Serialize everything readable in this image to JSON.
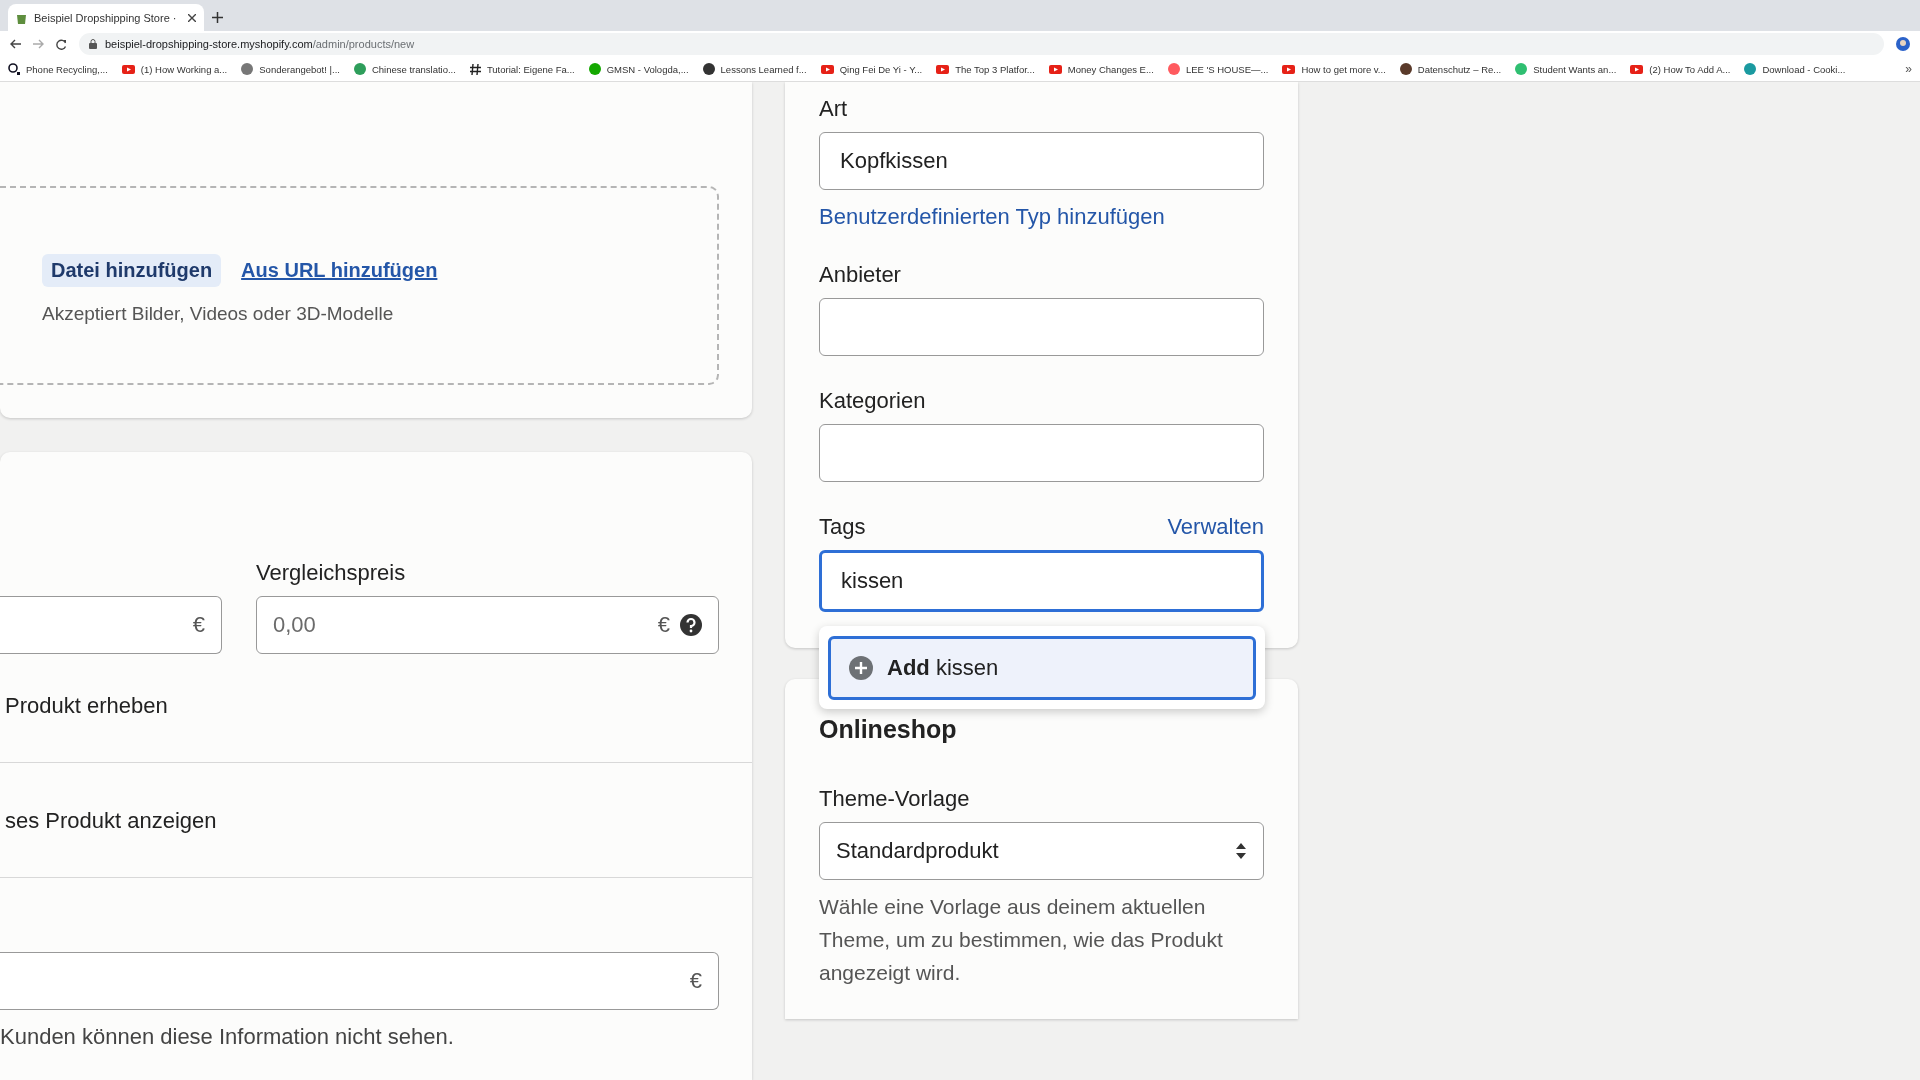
{
  "browser": {
    "tab_title": "Beispiel Dropshipping Store ·",
    "url_host": "beispiel-dropshipping-store.myshopify.com",
    "url_path": "/admin/products/new",
    "bookmarks": [
      {
        "label": "Phone Recycling,...",
        "kind": "ring"
      },
      {
        "label": "(1) How Working a...",
        "kind": "video"
      },
      {
        "label": "Sonderangebot! |...",
        "kind": "dot",
        "color": "#777777"
      },
      {
        "label": "Chinese translatio...",
        "kind": "dot",
        "color": "#2e9e5b"
      },
      {
        "label": "Tutorial: Eigene Fa...",
        "kind": "hash"
      },
      {
        "label": "GMSN - Vologda,...",
        "kind": "dot",
        "color": "#14a800"
      },
      {
        "label": "Lessons Learned f...",
        "kind": "dot",
        "color": "#333333"
      },
      {
        "label": "Qing Fei De Yi - Y...",
        "kind": "video"
      },
      {
        "label": "The Top 3 Platfor...",
        "kind": "video"
      },
      {
        "label": "Money Changes E...",
        "kind": "video"
      },
      {
        "label": "LEE 'S HOUSE—...",
        "kind": "dot",
        "color": "#ff5a5f"
      },
      {
        "label": "How to get more v...",
        "kind": "video"
      },
      {
        "label": "Datenschutz – Re...",
        "kind": "dot",
        "color": "#5a3a2a"
      },
      {
        "label": "Student Wants an...",
        "kind": "dot",
        "color": "#2fbf71"
      },
      {
        "label": "(2) How To Add A...",
        "kind": "video"
      },
      {
        "label": "Download - Cooki...",
        "kind": "dot",
        "color": "#1a9aa0"
      }
    ],
    "more": "»"
  },
  "media": {
    "add_file": "Datei hinzufügen",
    "add_url": "Aus URL hinzufügen",
    "hint": "Akzeptiert Bilder, Videos oder 3D-Modelle"
  },
  "pricing": {
    "price_currency": "€",
    "compare_label": "Vergleichspreis",
    "compare_placeholder": "0,00",
    "compare_currency": "€",
    "option_1": "Produkt erheben",
    "option_2": "ses Produkt anzeigen",
    "cost_currency": "€",
    "cost_note": "Kunden können diese Information nicht sehen."
  },
  "organization": {
    "fields": [
      {
        "label": "Art",
        "value": "Kopfkissen",
        "focused": false,
        "link": "Benutzerdefinierten Typ hinzufügen"
      },
      {
        "label": "Anbieter",
        "focused": false
      },
      {
        "label": "Kategorien",
        "focused": false
      },
      {
        "label": "Tags",
        "value": "kissen",
        "focused": true,
        "action": "Verwalten"
      }
    ],
    "suggestion": "**Add** kissen"
  },
  "online_store": {
    "title": "Onlineshop",
    "template_label": "Theme-Vorlage",
    "template_value": "Standardprodukt",
    "help": "Wähle eine Vorlage aus deinem aktuellen Theme, um zu bestimmen, wie das Produkt angezeigt wird."
  }
}
